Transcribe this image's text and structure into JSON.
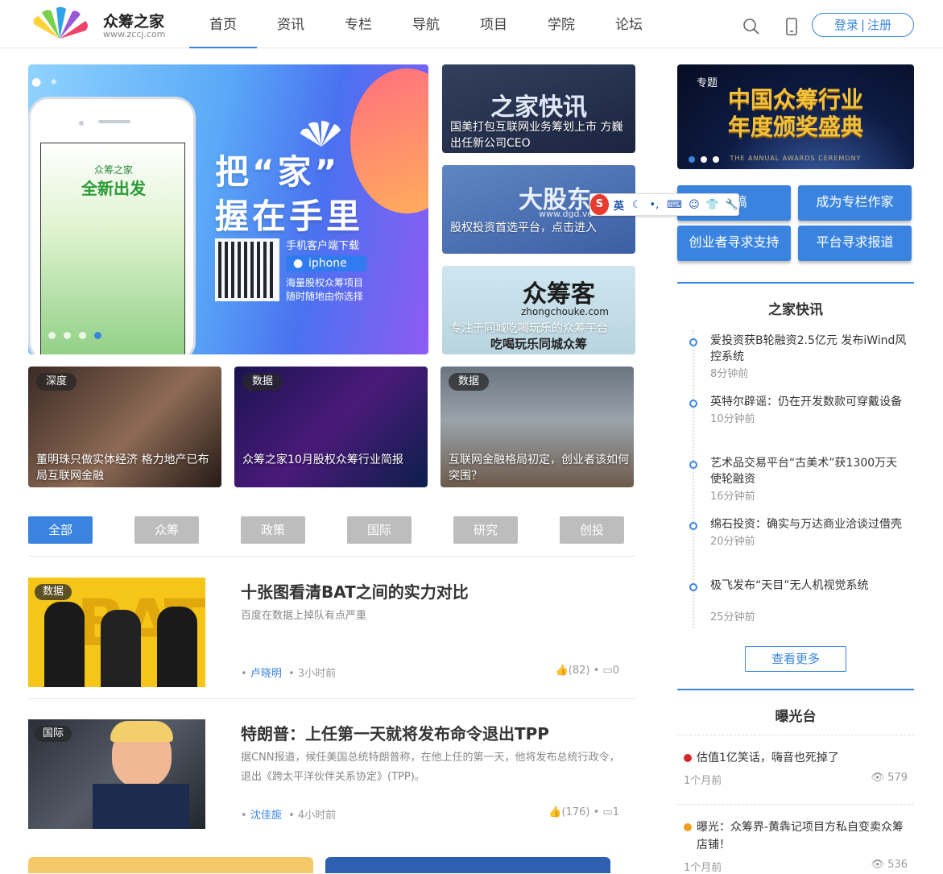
{
  "header": {
    "logo_title": "众筹之家",
    "logo_url": "www.zccj.com",
    "nav": [
      "首页",
      "资讯",
      "专栏",
      "导航",
      "项目",
      "学院",
      "论坛"
    ],
    "active_nav": "首页",
    "login": "登录",
    "sep": "|",
    "register": "注册"
  },
  "banner": {
    "line1": "把“家”",
    "line2": "握在手里",
    "download": "手机客户端下载",
    "platform": "iphone",
    "sub1": "海量股权众筹项目",
    "sub2": "随时随地由你选择",
    "phone_small": "众筹之家",
    "phone_big": "全新出发",
    "dots": 4,
    "active_dot": 4
  },
  "side_cards": [
    {
      "big": "之家快讯",
      "caption": "国美打包互联网业务筹划上市 方巍出任新公司CEO"
    },
    {
      "big": "大股东",
      "small": "www.dgd.vc",
      "caption": "股权投资首选平台，点击进入"
    },
    {
      "big": "众筹客",
      "small": "zhongchouke.com",
      "caption": "专注于同城吃喝玩乐的众筹平台",
      "caption2": "吃喝玩乐同城众筹"
    }
  ],
  "tiles": [
    {
      "tag": "深度",
      "caption": "董明珠只做实体经济 格力地产已布局互联网金融"
    },
    {
      "tag": "数据",
      "caption": "众筹之家10月股权众筹行业简报"
    },
    {
      "tag": "数据",
      "caption": "互联网金融格局初定，创业者该如何突围？"
    }
  ],
  "filter_tabs": [
    "全部",
    "众筹",
    "政策",
    "国际",
    "研究",
    "创投"
  ],
  "active_tab": "全部",
  "articles": [
    {
      "tag": "数据",
      "title": "十张图看清BAT之间的实力对比",
      "summary": "百度在数据上掉队有点严重",
      "author": "卢晓明",
      "time": "3小时前",
      "likes": "(82)",
      "comments": "0",
      "thumb_text": "BAT"
    },
    {
      "tag": "国际",
      "title": "特朗普：上任第一天就将发布命令退出TPP",
      "summary": "据CNN报道，候任美国总统特朗普称，在他上任的第一天，他将发布总统行政令，退出《跨太平洋伙伴关系协定》(TPP)。",
      "author": "沈佳旎",
      "time": "4小时前",
      "likes": "(176)",
      "comments": "1"
    }
  ],
  "promo": {
    "tag": "专题",
    "line1": "中国众筹行业",
    "line2": "年度颁奖盛典",
    "small": "THE ANNUAL AWARDS CEREMONY",
    "dots": 3,
    "active_dot": 1
  },
  "actions": [
    "投稿",
    "成为专栏作家",
    "创业者寻求支持",
    "平台寻求报道"
  ],
  "ime": {
    "logo": "S",
    "mode": "英"
  },
  "flash": {
    "title": "之家快讯",
    "items": [
      {
        "title": "爱投资获B轮融资2.5亿元 发布iWind风控系统",
        "time": "8分钟前"
      },
      {
        "title": "英特尔辟谣：仍在开发数款可穿戴设备",
        "time": "10分钟前"
      },
      {
        "title": "艺术品交易平台“古美术”获1300万天使轮融资",
        "time": "16分钟前"
      },
      {
        "title": "绵石投资：确实与万达商业洽谈过借壳",
        "time": "20分钟前"
      },
      {
        "title": "极飞发布“天目”无人机视觉系统",
        "time": "25分钟前"
      }
    ],
    "more": "查看更多"
  },
  "expose": {
    "title": "曝光台",
    "items": [
      {
        "title": "估值1亿笑话，嗨音也死掉了",
        "time": "1个月前",
        "views": "579",
        "color": "#d7262a"
      },
      {
        "title": "曝光：众筹界-黄犇记项目方私自变卖众筹店铺！",
        "time": "1个月前",
        "views": "536",
        "color": "#f0a020"
      }
    ]
  },
  "colors": {
    "accent": "#3a84e0",
    "tab_inactive": "#bdbdbd"
  }
}
